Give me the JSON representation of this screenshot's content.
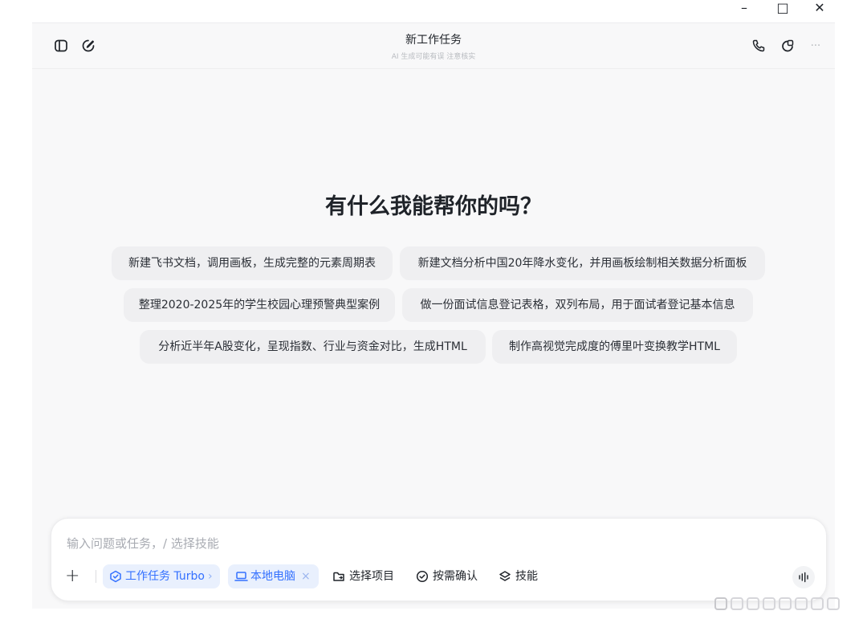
{
  "window": {
    "minimize_icon": "minimize-icon",
    "maximize_icon": "maximize-icon",
    "close_icon": "close-icon",
    "minimize_glyph": "–",
    "maximize_glyph": "□",
    "close_glyph": "✕"
  },
  "header": {
    "title": "新工作任务",
    "subtitle": "AI 生成可能有误 注意核实",
    "left_icons": [
      "sidebar-toggle-icon",
      "new-chat-icon"
    ],
    "right_icons": [
      "phone-icon",
      "share-icon",
      "more-icon"
    ],
    "more_glyph": "···"
  },
  "main": {
    "headline": "有什么我能帮你的吗？",
    "suggestions": [
      "新建飞书文档，调用画板，生成完整的元素周期表",
      "新建文档分析中国20年降水变化，并用画板绘制相关数据分析面板",
      "整理2020-2025年的学生校园心理预警典型案例",
      "做一份面试信息登记表格，双列布局，用于面试者登记基本信息",
      "分析近半年A股变化，呈现指数、行业与资金对比，生成HTML",
      "制作高视觉完成度的傅里叶变换教学HTML"
    ]
  },
  "composer": {
    "placeholder": "输入问题或任务，/ 选择技能",
    "add_glyph": "+",
    "mode_label": "工作任务 Turbo",
    "mode_chevron": "›",
    "device_label": "本地电脑",
    "device_close": "×",
    "select_project_label": "选择项目",
    "confirm_label": "按需确认",
    "skills_label": "技能",
    "accent": "#3370ff"
  }
}
